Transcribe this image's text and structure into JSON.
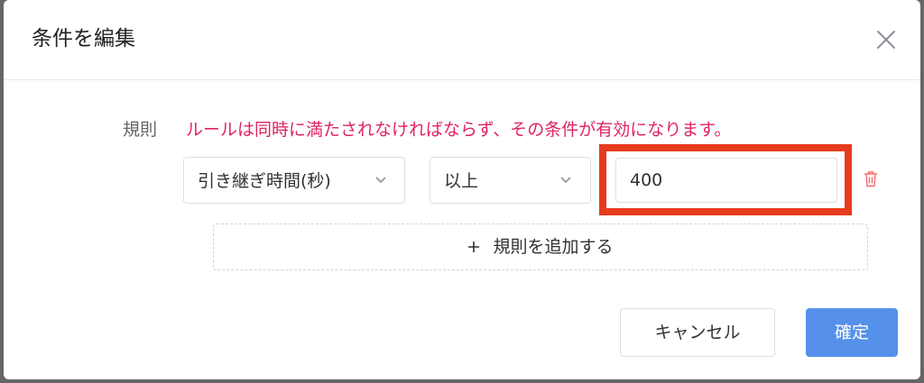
{
  "dialog": {
    "title": "条件を編集",
    "close_icon": "close-icon"
  },
  "rule": {
    "label": "規則",
    "note": "ルールは同時に満たされなければならず、その条件が有効になります。"
  },
  "condition": {
    "field_select": {
      "value": "引き継ぎ時間(秒)",
      "icon": "chevron-down-icon"
    },
    "operator_select": {
      "value": "以上",
      "icon": "chevron-down-icon"
    },
    "value_input": {
      "value": "400"
    },
    "delete_icon": "trash-icon"
  },
  "add_rule": {
    "icon": "plus-icon",
    "label": "規則を追加する"
  },
  "footer": {
    "cancel_label": "キャンセル",
    "confirm_label": "確定"
  },
  "colors": {
    "note": "#e0245e",
    "primary": "#5591ea",
    "highlight": "#e63b1e",
    "delete": "#f56c6c"
  }
}
